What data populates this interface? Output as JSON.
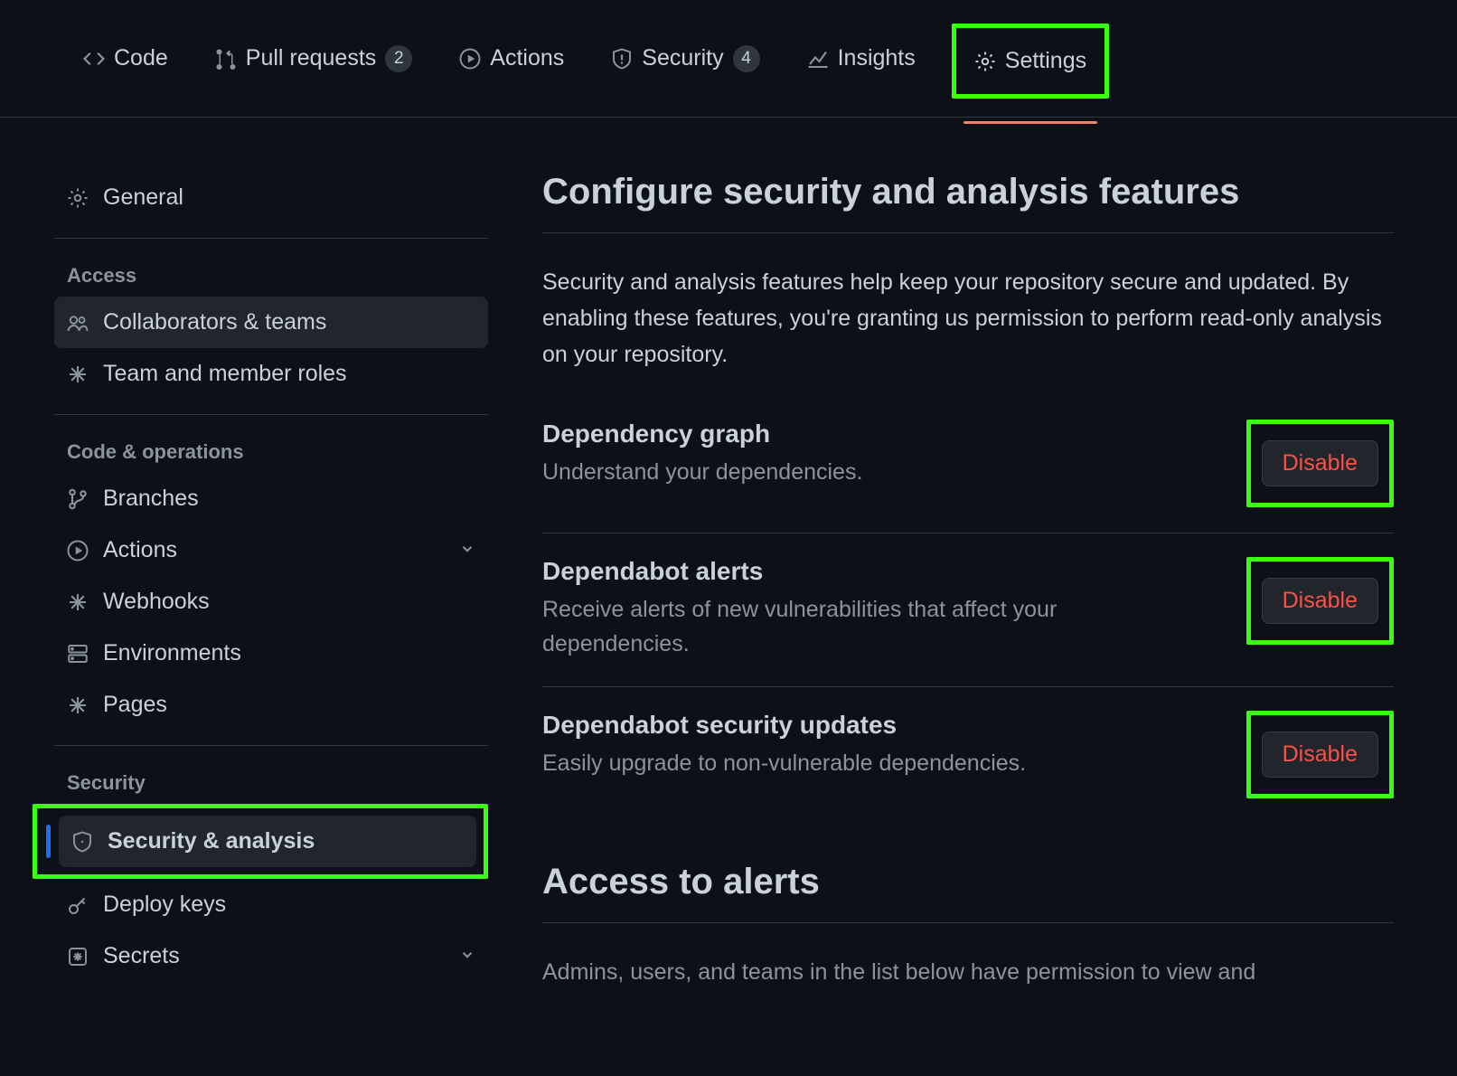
{
  "topnav": {
    "code": "Code",
    "pull_requests": "Pull requests",
    "pull_requests_count": "2",
    "actions": "Actions",
    "security": "Security",
    "security_count": "4",
    "insights": "Insights",
    "settings": "Settings"
  },
  "sidebar": {
    "general": "General",
    "access_heading": "Access",
    "collaborators": "Collaborators & teams",
    "team_roles": "Team and member roles",
    "codeops_heading": "Code & operations",
    "branches": "Branches",
    "actions": "Actions",
    "webhooks": "Webhooks",
    "environments": "Environments",
    "pages": "Pages",
    "security_heading": "Security",
    "security_analysis": "Security & analysis",
    "deploy_keys": "Deploy keys",
    "secrets": "Secrets"
  },
  "main": {
    "title": "Configure security and analysis features",
    "intro": "Security and analysis features help keep your repository secure and updated. By enabling these features, you're granting us permission to perform read-only analysis on your repository.",
    "features": [
      {
        "title": "Dependency graph",
        "desc": "Understand your dependencies.",
        "button": "Disable"
      },
      {
        "title": "Dependabot alerts",
        "desc": "Receive alerts of new vulnerabilities that affect your dependencies.",
        "button": "Disable"
      },
      {
        "title": "Dependabot security updates",
        "desc": "Easily upgrade to non-vulnerable dependencies.",
        "button": "Disable"
      }
    ],
    "access_title": "Access to alerts",
    "access_body": "Admins, users, and teams in the list below have permission to view and"
  }
}
